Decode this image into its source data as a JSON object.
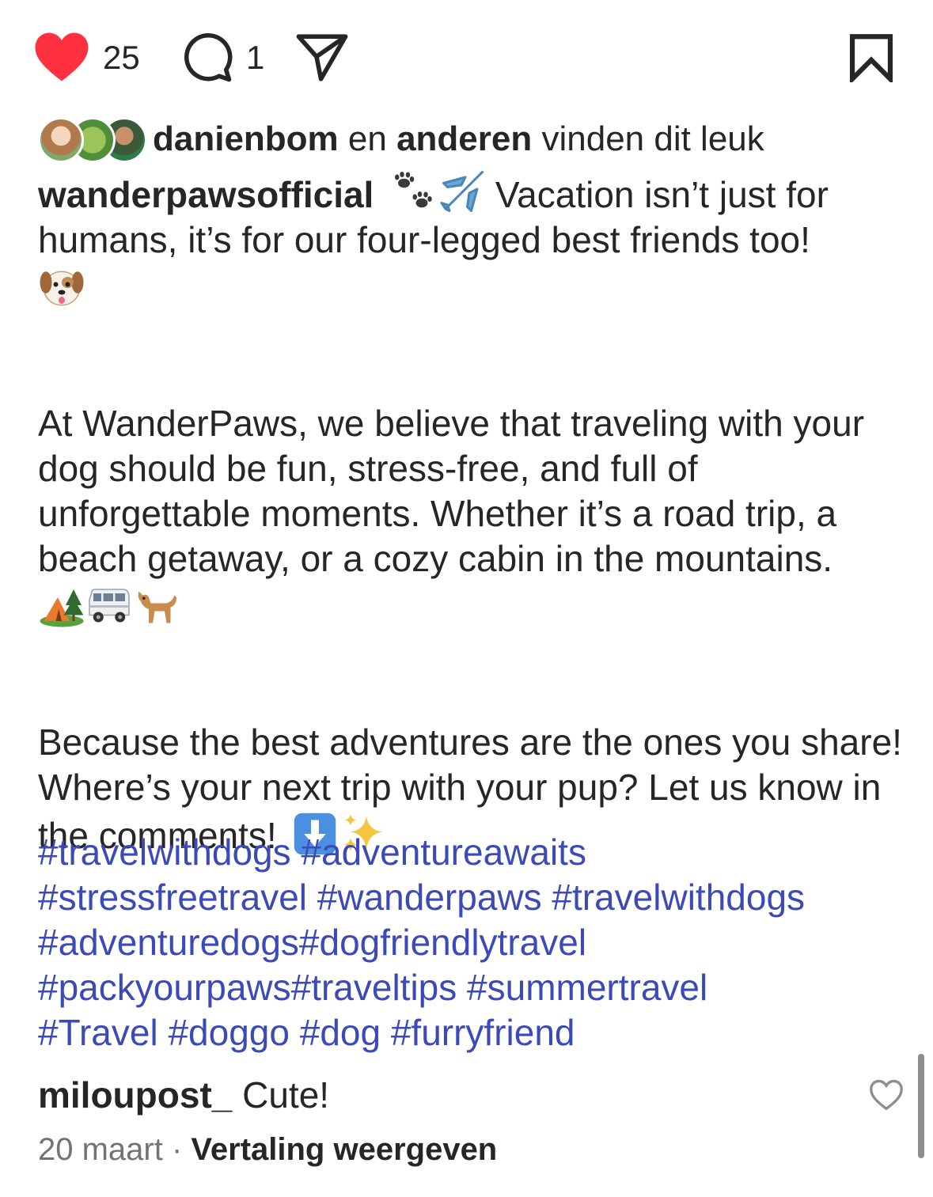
{
  "actions": {
    "like_count": "25",
    "comment_count": "1",
    "icons": {
      "like": "heart-filled-icon",
      "comment": "comment-bubble-icon",
      "share": "paper-plane-icon",
      "save": "bookmark-icon"
    },
    "like_color": "#ff3040"
  },
  "likes": {
    "user": "danienbom",
    "conj": " en ",
    "others": "anderen",
    "suffix": " vinden dit leuk"
  },
  "post": {
    "author": "wanderpawsofficial",
    "intro_text": " Vacation isn’t just for humans, it’s for our four-legged best friends too!",
    "paragraph2": "At WanderPaws, we believe that traveling with your dog should be fun, stress-free, and full of unforgettable moments. Whether it’s a road trip, a beach getaway, or a cozy cabin in the mountains.",
    "paragraph3": "Because the best adventures are the ones you share! Where’s your next trip with your pup? Let us know in the comments!",
    "emojis": [
      "paws",
      "airplane",
      "dog-face",
      "camping",
      "minibus",
      "dog",
      "down-arrow",
      "sparkles"
    ]
  },
  "hashtags": {
    "line1": "#travelwithdogs #adventureawaits",
    "line2": "#stressfreetravel #wanderpaws #travelwithdogs",
    "line3": "#adventuredogs#dogfriendlytravel",
    "line4": "#packyourpaws#traveltips #summertravel",
    "line5": "#Travel #doggo #dog #furryfriend",
    "color": "#3c4ab8"
  },
  "comment": {
    "user": "miloupost_",
    "text": " Cute!",
    "date": "20 maart",
    "separator": " · ",
    "translate": "Vertaling weergeven"
  }
}
